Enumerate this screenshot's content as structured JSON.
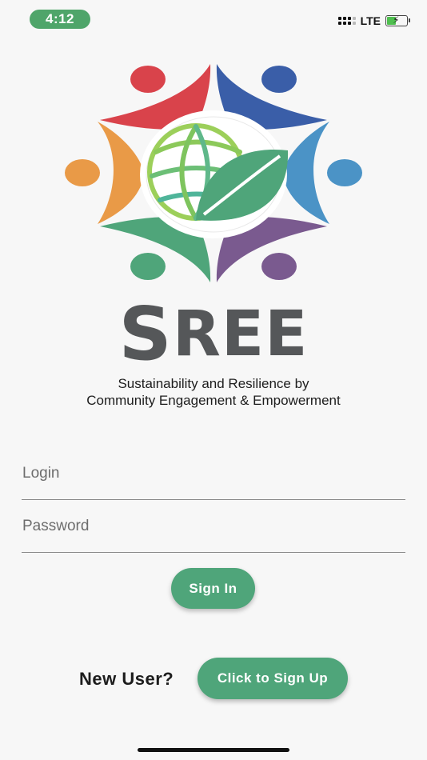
{
  "status_bar": {
    "time": "4:12",
    "network": "LTE"
  },
  "brand": {
    "wordmark_first": "S",
    "wordmark_rest": "REE",
    "tagline_line1": "Sustainability and Resilience by",
    "tagline_line2": "Community Engagement & Empowerment"
  },
  "form": {
    "login_placeholder": "Login",
    "password_placeholder": "Password",
    "signin_label": "Sign In"
  },
  "signup": {
    "prompt": "New User?",
    "button_label": "Click to Sign Up"
  },
  "colors": {
    "accent_green": "#4fa57a",
    "logo_red": "#d9434b",
    "logo_blue": "#3a5ea8",
    "logo_orange": "#e99a47",
    "logo_lightblue": "#4b93c6",
    "logo_green": "#4fa57a",
    "logo_purple": "#7a5a8f"
  }
}
